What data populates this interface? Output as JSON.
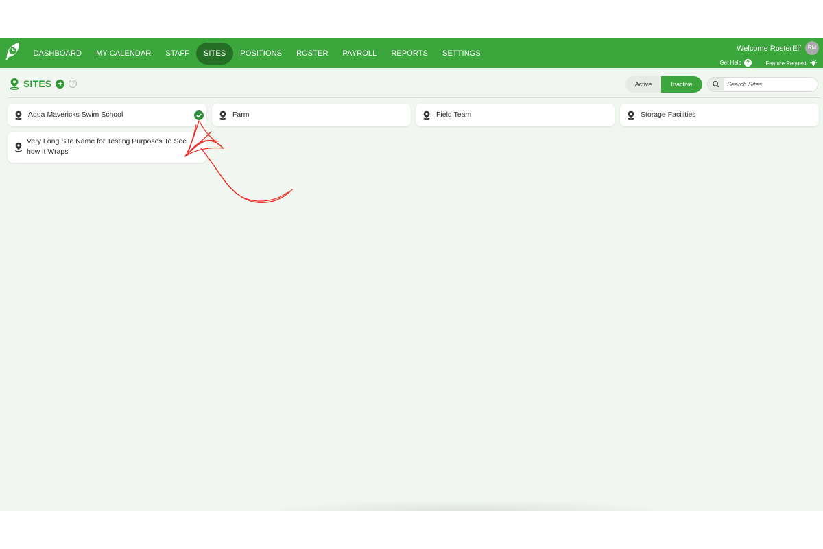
{
  "app": {
    "brand_color": "#3aa63c",
    "active_color": "#256e25"
  },
  "nav": {
    "items": [
      {
        "label": "DASHBOARD"
      },
      {
        "label": "MY CALENDAR"
      },
      {
        "label": "STAFF"
      },
      {
        "label": "SITES",
        "active": true
      },
      {
        "label": "POSITIONS"
      },
      {
        "label": "ROSTER"
      },
      {
        "label": "PAYROLL"
      },
      {
        "label": "REPORTS"
      },
      {
        "label": "SETTINGS"
      }
    ]
  },
  "user": {
    "welcome": "Welcome RosterElf",
    "initials": "RM"
  },
  "help": {
    "get_help": "Get Help",
    "feature_request": "Feature Request"
  },
  "page": {
    "title": "SITES"
  },
  "filter": {
    "active_label": "Active",
    "inactive_label": "Inactive",
    "selected": "Inactive"
  },
  "search": {
    "placeholder": "Search Sites",
    "value": ""
  },
  "sites": [
    {
      "name": "Aqua Mavericks Swim School",
      "selected": true
    },
    {
      "name": "Farm"
    },
    {
      "name": "Field Team"
    },
    {
      "name": "Storage Facilities"
    },
    {
      "name": "Very Long Site Name for Testing Purposes To See how it Wraps"
    }
  ],
  "icons": {
    "logo": "leaf-clock-icon",
    "site": "map-pin-icon",
    "check": "check-circle-icon",
    "search": "search-icon",
    "help": "question-icon",
    "feature": "lightbulb-icon",
    "add": "plus-circle-icon",
    "info": "info-icon"
  }
}
